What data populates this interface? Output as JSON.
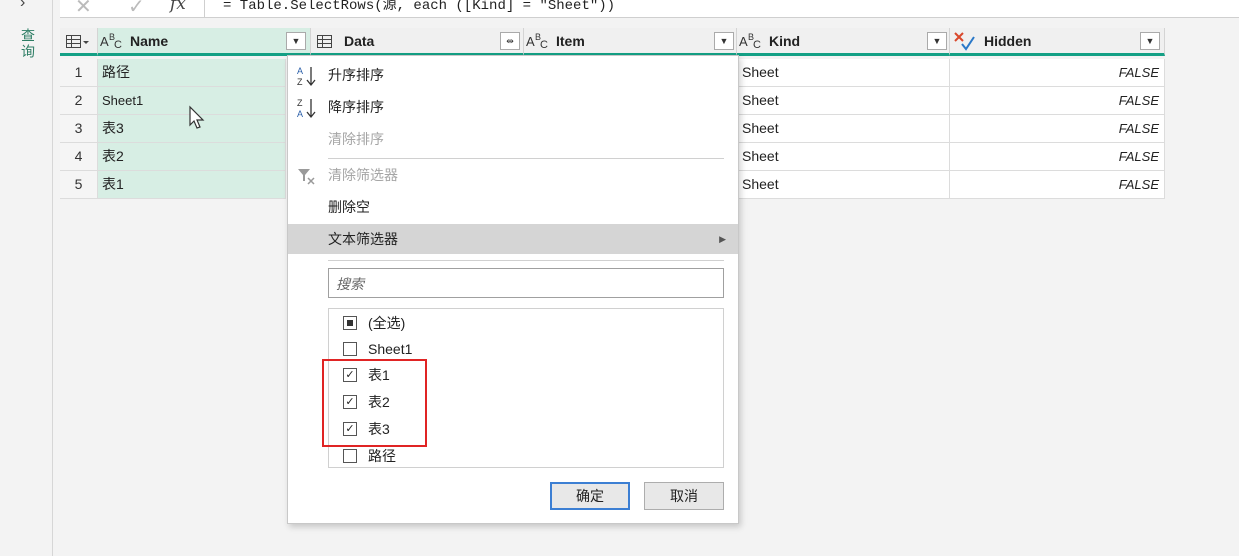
{
  "left_pane": {
    "label": "查询"
  },
  "formula_bar": {
    "x": "✕",
    "check": "✓",
    "fx": "fx",
    "formula": "= Table.SelectRows(源, each ([Kind] = \"Sheet\"))"
  },
  "columns": {
    "name": {
      "type_icon": "ABC",
      "label": "Name"
    },
    "data": {
      "type_icon": "table-icon",
      "label": "Data"
    },
    "item": {
      "type_icon": "ABC",
      "label": "Item"
    },
    "kind": {
      "type_icon": "ABC",
      "label": "Kind"
    },
    "hidden": {
      "type_icon": "logical-icon",
      "label": "Hidden"
    }
  },
  "rows": [
    {
      "num": "1",
      "name": "路径",
      "kind": "Sheet",
      "hidden": "FALSE"
    },
    {
      "num": "2",
      "name": "Sheet1",
      "kind": "Sheet",
      "hidden": "FALSE"
    },
    {
      "num": "3",
      "name": "表3",
      "kind": "Sheet",
      "hidden": "FALSE"
    },
    {
      "num": "4",
      "name": "表2",
      "kind": "Sheet",
      "hidden": "FALSE"
    },
    {
      "num": "5",
      "name": "表1",
      "kind": "Sheet",
      "hidden": "FALSE"
    }
  ],
  "menu": {
    "sort_asc": "升序排序",
    "sort_desc": "降序排序",
    "clear_sort": "清除排序",
    "clear_filter": "清除筛选器",
    "remove_empty": "删除空",
    "text_filters": "文本筛选器",
    "search_placeholder": "搜索",
    "items": [
      {
        "label": "(全选)",
        "state": "partial"
      },
      {
        "label": "Sheet1",
        "state": "unchecked"
      },
      {
        "label": "表1",
        "state": "checked"
      },
      {
        "label": "表2",
        "state": "checked"
      },
      {
        "label": "表3",
        "state": "checked"
      },
      {
        "label": "路径",
        "state": "unchecked"
      }
    ],
    "ok": "确定",
    "cancel": "取消"
  },
  "colors": {
    "accent": "#14a085",
    "selected_col": "#d7eee4",
    "highlight_box": "#e02424"
  }
}
